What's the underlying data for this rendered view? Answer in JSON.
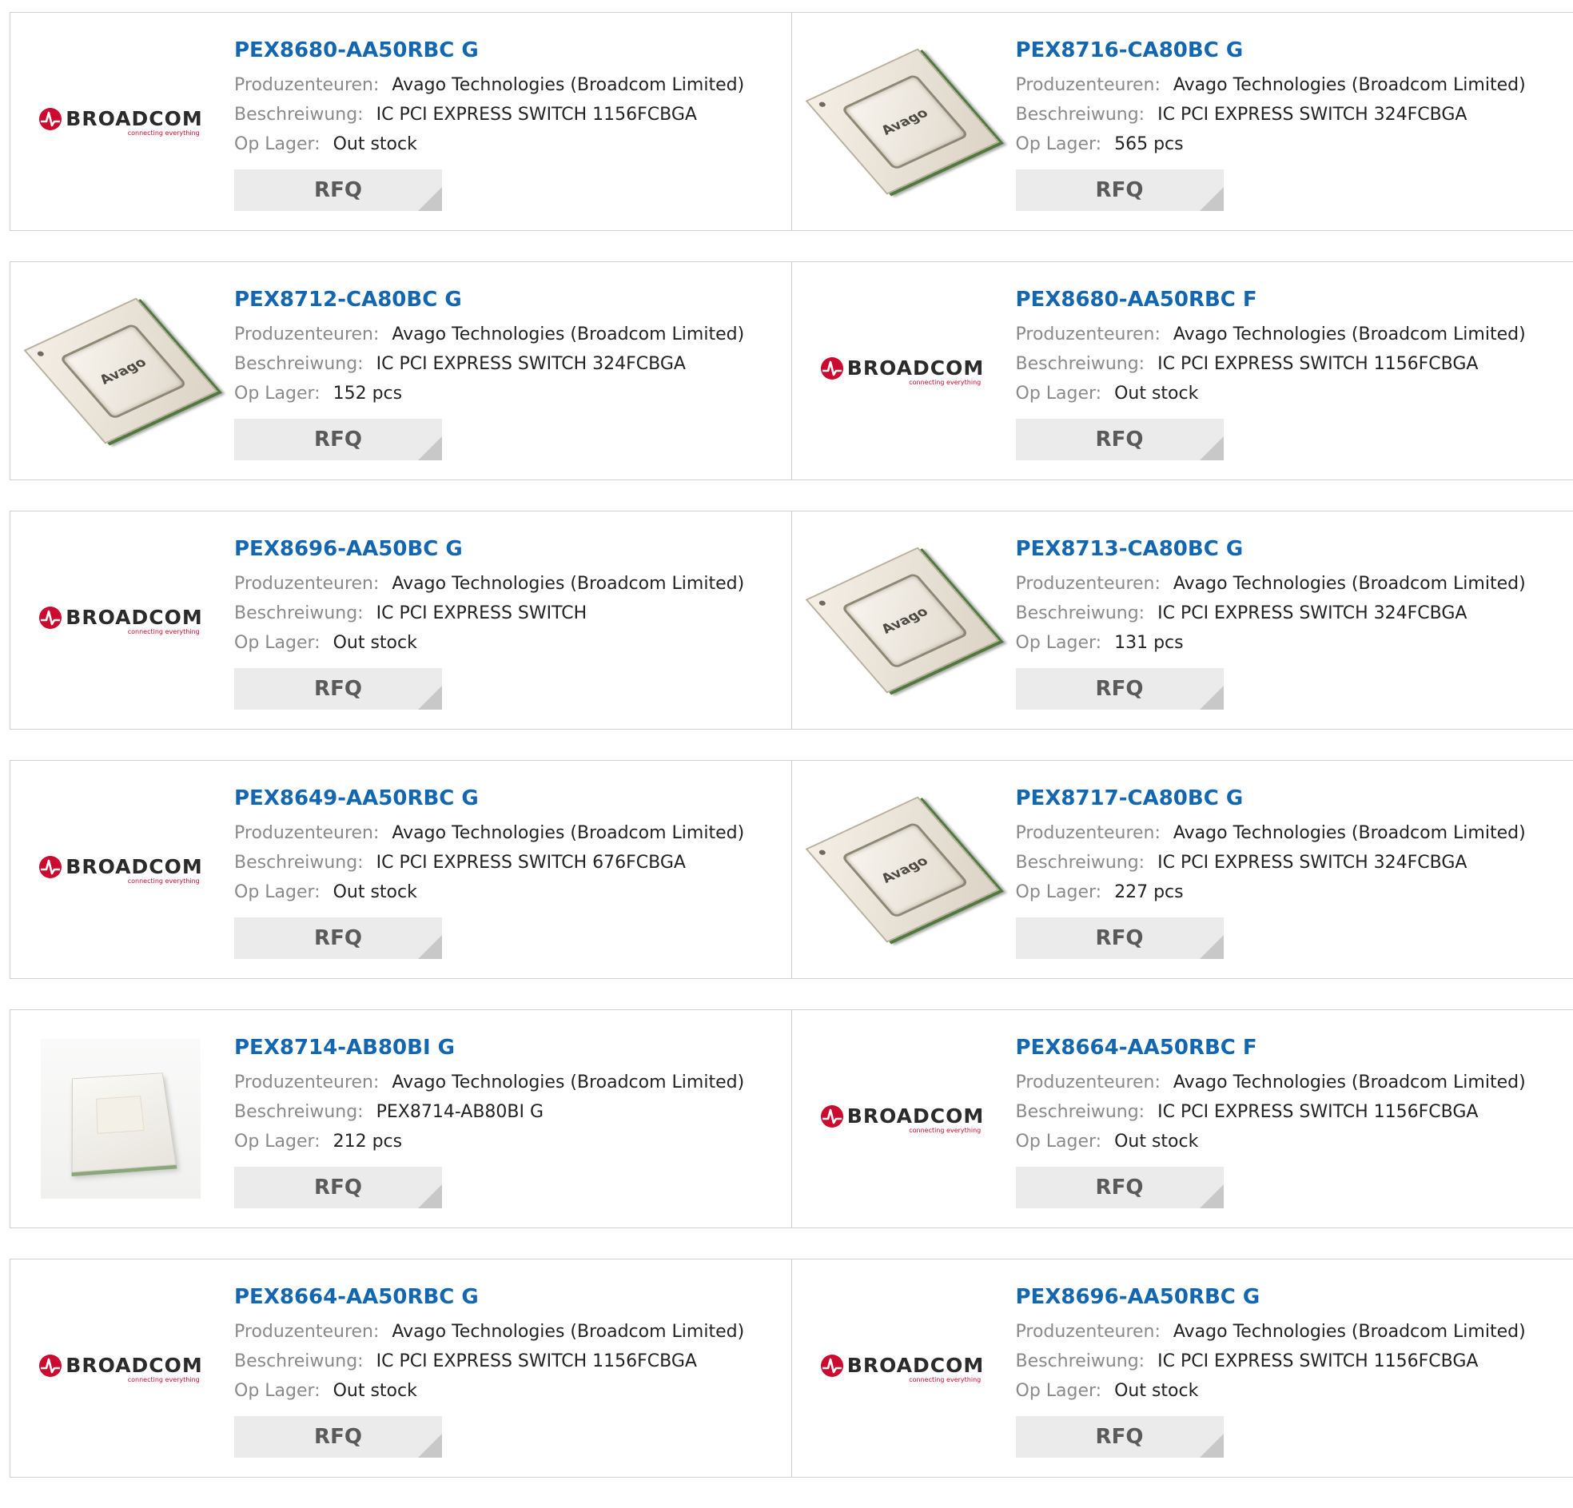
{
  "labels": {
    "manufacturer": "Produzenteuren:",
    "description": "Beschreiwung:",
    "stock": "Op Lager:",
    "rfq": "RFQ"
  },
  "logos": {
    "broadcom": "BROADCOM",
    "broadcom_tagline": "connecting everything",
    "avago": "Avago"
  },
  "products": [
    {
      "part": "PEX8680-AA50RBC G",
      "manufacturer": "Avago Technologies (Broadcom Limited)",
      "description": "IC PCI EXPRESS SWITCH 1156FCBGA",
      "stock": "Out stock",
      "image": "broadcom-logo"
    },
    {
      "part": "PEX8716-CA80BC G",
      "manufacturer": "Avago Technologies (Broadcom Limited)",
      "description": "IC PCI EXPRESS SWITCH 324FCBGA",
      "stock": "565 pcs",
      "image": "avago-chip"
    },
    {
      "part": "PEX8712-CA80BC G",
      "manufacturer": "Avago Technologies (Broadcom Limited)",
      "description": "IC PCI EXPRESS SWITCH 324FCBGA",
      "stock": "152 pcs",
      "image": "avago-chip"
    },
    {
      "part": "PEX8680-AA50RBC F",
      "manufacturer": "Avago Technologies (Broadcom Limited)",
      "description": "IC PCI EXPRESS SWITCH 1156FCBGA",
      "stock": "Out stock",
      "image": "broadcom-logo"
    },
    {
      "part": "PEX8696-AA50BC G",
      "manufacturer": "Avago Technologies (Broadcom Limited)",
      "description": "IC PCI EXPRESS SWITCH",
      "stock": "Out stock",
      "image": "broadcom-logo"
    },
    {
      "part": "PEX8713-CA80BC G",
      "manufacturer": "Avago Technologies (Broadcom Limited)",
      "description": "IC PCI EXPRESS SWITCH 324FCBGA",
      "stock": "131 pcs",
      "image": "avago-chip"
    },
    {
      "part": "PEX8649-AA50RBC G",
      "manufacturer": "Avago Technologies (Broadcom Limited)",
      "description": "IC PCI EXPRESS SWITCH 676FCBGA",
      "stock": "Out stock",
      "image": "broadcom-logo"
    },
    {
      "part": "PEX8717-CA80BC G",
      "manufacturer": "Avago Technologies (Broadcom Limited)",
      "description": "IC PCI EXPRESS SWITCH 324FCBGA",
      "stock": "227 pcs",
      "image": "avago-chip"
    },
    {
      "part": "PEX8714-AB80BI G",
      "manufacturer": "Avago Technologies (Broadcom Limited)",
      "description": "PEX8714-AB80BI G",
      "stock": "212 pcs",
      "image": "white-chip"
    },
    {
      "part": "PEX8664-AA50RBC F",
      "manufacturer": "Avago Technologies (Broadcom Limited)",
      "description": "IC PCI EXPRESS SWITCH 1156FCBGA",
      "stock": "Out stock",
      "image": "broadcom-logo"
    },
    {
      "part": "PEX8664-AA50RBC G",
      "manufacturer": "Avago Technologies (Broadcom Limited)",
      "description": "IC PCI EXPRESS SWITCH 1156FCBGA",
      "stock": "Out stock",
      "image": "broadcom-logo"
    },
    {
      "part": "PEX8696-AA50RBC G",
      "manufacturer": "Avago Technologies (Broadcom Limited)",
      "description": "IC PCI EXPRESS SWITCH 1156FCBGA",
      "stock": "Out stock",
      "image": "broadcom-logo"
    }
  ],
  "colors": {
    "link": "#1366b0",
    "label": "#8a8a8a",
    "brand_red": "#cc092f",
    "rfq_bg": "#ebebeb"
  }
}
